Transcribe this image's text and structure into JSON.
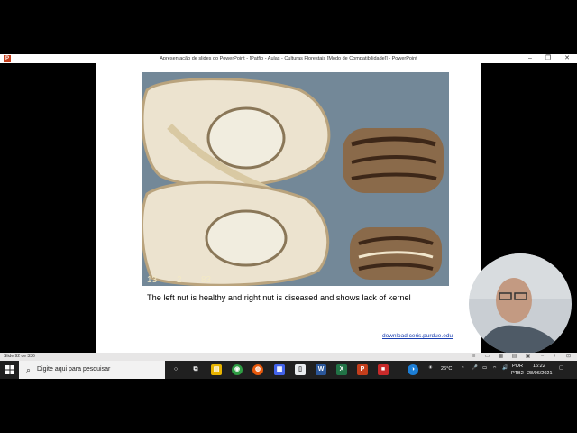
{
  "window": {
    "title": "Apresentação de slides do PowerPoint - [Patfio - Aulas - Culturas Florestais [Modo de Compatibilidade]] - PowerPoint",
    "app_icon": "P",
    "controls": {
      "minimize": "–",
      "restore": "❐",
      "close": "✕"
    }
  },
  "slide": {
    "caption": "The left nut is healthy and right nut is diseased and shows lack of kernel",
    "link": "download ceris.purdue.edu",
    "photo_stamp": [
      "13",
      "2",
      "83"
    ]
  },
  "status": {
    "slide_number": "Slide 92 de 336"
  },
  "taskbar": {
    "search_placeholder": "Digite aqui para pesquisar",
    "weather": "26°C",
    "lang_top": "POR",
    "lang_bottom": "PTB2",
    "time": "16:22",
    "date": "28/06/2021",
    "apps": [
      "task-view",
      "file-explorer",
      "chrome",
      "firefox",
      "calculator",
      "notepad",
      "word",
      "excel",
      "powerpoint",
      "media",
      "mixed"
    ]
  },
  "colors": {
    "ppt": "#c43e1c",
    "word": "#2b579a",
    "excel": "#217346",
    "link": "#1a3fb0"
  }
}
